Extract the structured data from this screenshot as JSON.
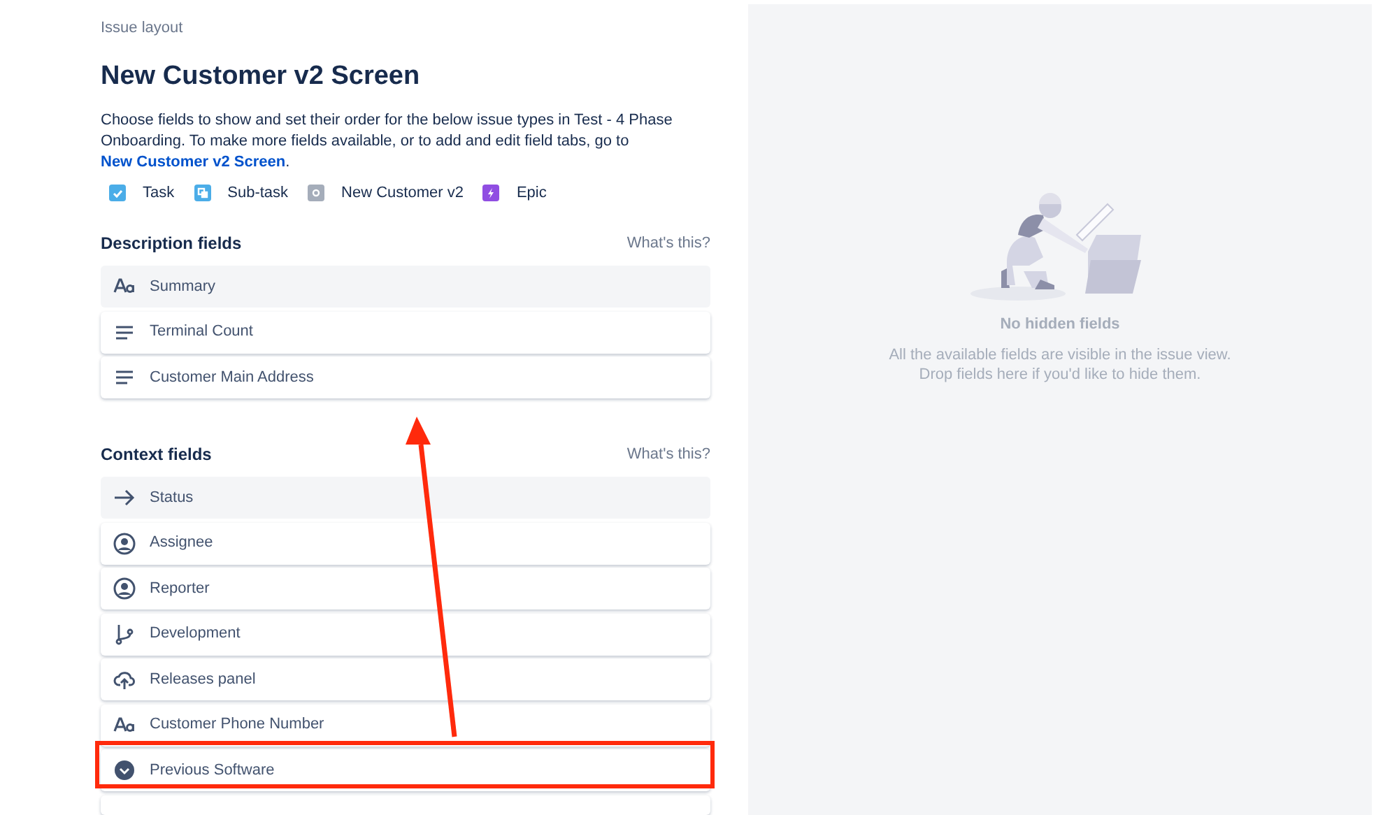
{
  "breadcrumb": "Issue layout",
  "title": "New Customer v2 Screen",
  "description": "Choose fields to show and set their order for the below issue types in Test - 4 Phase Onboarding. To make more fields available, or to add and edit field tabs, go to",
  "link": "New Customer v2 Screen",
  "link_suffix": ".",
  "issue_types": [
    {
      "label": "Task",
      "kind": "task",
      "color": "#4bade8"
    },
    {
      "label": "Sub-task",
      "kind": "subtask",
      "color": "#4bade8"
    },
    {
      "label": "New Customer v2",
      "kind": "generic",
      "color": "#a5adba"
    },
    {
      "label": "Epic",
      "kind": "epic",
      "color": "#904ee2"
    }
  ],
  "sections": [
    {
      "title": "Description fields",
      "help": "What's this?",
      "fields": [
        {
          "label": "Summary",
          "kind": "text",
          "locked": true
        },
        {
          "label": "Terminal Count",
          "kind": "paragraph",
          "locked": false
        },
        {
          "label": "Customer Main Address",
          "kind": "paragraph",
          "locked": false
        }
      ]
    },
    {
      "title": "Context fields",
      "help": "What's this?",
      "fields": [
        {
          "label": "Status",
          "kind": "status",
          "locked": true
        },
        {
          "label": "Assignee",
          "kind": "user",
          "locked": false
        },
        {
          "label": "Reporter",
          "kind": "user",
          "locked": false
        },
        {
          "label": "Development",
          "kind": "development",
          "locked": false
        },
        {
          "label": "Releases panel",
          "kind": "releases",
          "locked": false
        },
        {
          "label": "Customer Phone Number",
          "kind": "text",
          "locked": false
        },
        {
          "label": "Previous Software",
          "kind": "select",
          "locked": false,
          "highlighted": true
        }
      ]
    }
  ],
  "hidden_panel": {
    "title": "No hidden fields",
    "lines": [
      "All the available fields are visible in the issue view.",
      "Drop fields here if you'd like to hide them."
    ]
  }
}
